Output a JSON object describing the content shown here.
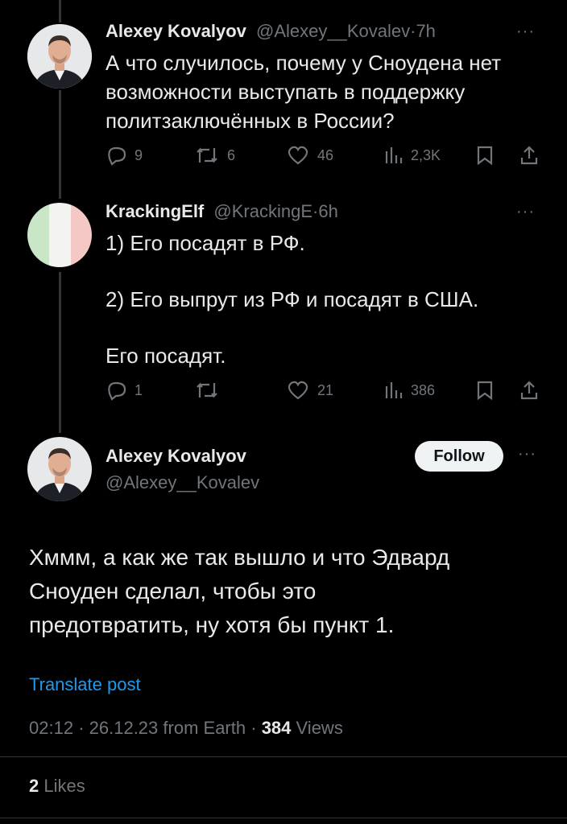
{
  "tweet1": {
    "name": "Alexey Kovalyov",
    "handle": "@Alexey__Kovalev",
    "dot": "·",
    "time": "7h",
    "text_lines": [
      "А что случилось, почему у Сноудена нет",
      "возможности выступать в поддержку",
      "политзаключённых в России?"
    ],
    "replies": "9",
    "retweets": "6",
    "likes": "46",
    "views": "2,3K"
  },
  "tweet2": {
    "name": "KrackingElf",
    "handle": "@KrackingE",
    "dot": "·",
    "time": "6h",
    "text_lines": [
      "1) Его посадят в РФ.",
      "2) Его выпрут из РФ и посадят в США.",
      "Его посадят."
    ],
    "replies": "1",
    "retweets": "",
    "likes": "21",
    "views": "386"
  },
  "main": {
    "name": "Alexey Kovalyov",
    "handle": "@Alexey__Kovalev",
    "follow_label": "Follow",
    "text_lines": [
      "Хммм, а как же так вышло и что Эдвард",
      "Сноуден сделал, чтобы это",
      "предотвратить, ну хотя бы пункт 1."
    ],
    "translate_label": "Translate post",
    "time": "02:12",
    "date": "26.12.23",
    "source": "from Earth",
    "views_count": "384",
    "views_label": "Views",
    "likes_count": "2",
    "likes_label": "Likes"
  },
  "more_label": "···",
  "sep": "·",
  "colors": {
    "background": "#000000",
    "text": "#e7e9ea",
    "muted": "#71767b",
    "link": "#1d9bf0",
    "thread_line": "#333639",
    "follow_bg": "#eff3f4"
  }
}
